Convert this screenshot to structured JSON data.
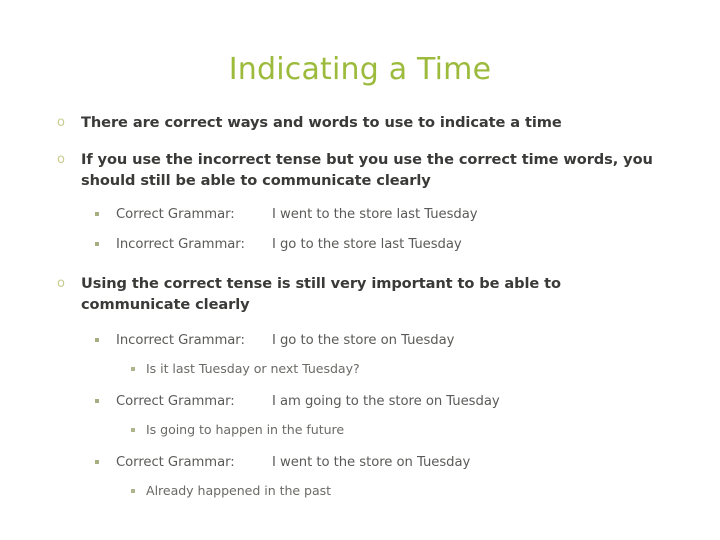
{
  "slide": {
    "title": "Indicating a Time",
    "theme": {
      "title_color": "#9cbb3c",
      "level1_marker_color": "#c8cc90",
      "level1_text_color": "#3a3a38",
      "level2_marker_color": "#a9ae82",
      "level2_text_color": "#5a5a58",
      "level3_marker_color": "#aeb48b",
      "level3_text_color": "#6a6a66",
      "background_color": "#ffffff"
    },
    "markers": {
      "level1": "o",
      "level2": "square-bullet",
      "level3": "square-bullet"
    },
    "bullets": {
      "b1": "There are correct ways and words to use to indicate a time",
      "b2": "If you use the incorrect tense but you use the correct time words, you should still be able to communicate clearly",
      "b2_s1_label": "Correct Grammar:",
      "b2_s1_example": "I went to the store last Tuesday",
      "b2_s2_label": "Incorrect Grammar:",
      "b2_s2_example": "I go to the store last Tuesday",
      "b3": "Using the correct tense is still very important to be able to communicate clearly",
      "b3_s1_label": "Incorrect Grammar:",
      "b3_s1_example": "I go to the store on Tuesday",
      "b3_s1_sub": "Is it last Tuesday or next Tuesday?",
      "b3_s2_label": "Correct Grammar:",
      "b3_s2_example": "I am going to the store on Tuesday",
      "b3_s2_sub": "Is going to happen in the future",
      "b3_s3_label": "Correct Grammar:",
      "b3_s3_example": "I went to the store on Tuesday",
      "b3_s3_sub": "Already happened in the past"
    }
  }
}
